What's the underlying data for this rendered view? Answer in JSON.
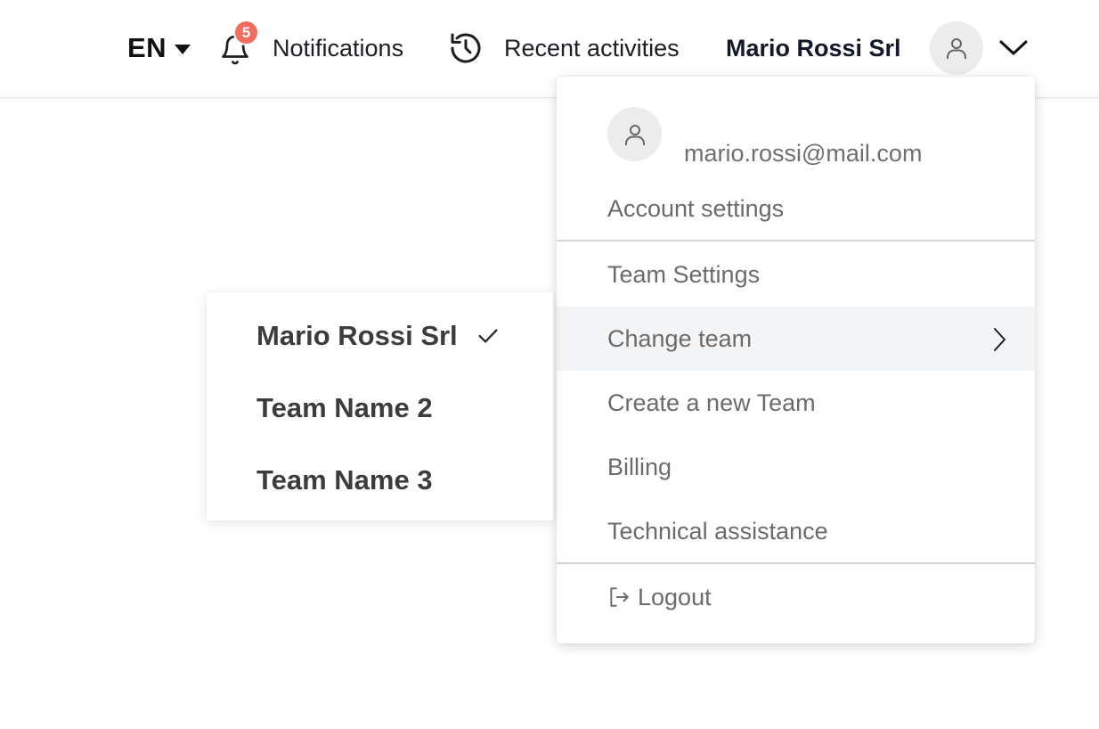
{
  "header": {
    "language": "EN",
    "notifications_label": "Notifications",
    "notifications_count": "5",
    "recent_label": "Recent activities",
    "company_name": "Mario Rossi Srl"
  },
  "menu": {
    "email": "mario.rossi@mail.com",
    "account_settings": "Account settings",
    "team_settings": "Team Settings",
    "change_team": "Change team",
    "create_team": "Create a new Team",
    "billing": "Billing",
    "technical_assistance": "Technical assistance",
    "logout": "Logout"
  },
  "teams": {
    "items": [
      {
        "name": "Mario Rossi Srl",
        "selected": true
      },
      {
        "name": "Team Name 2",
        "selected": false
      },
      {
        "name": "Team Name 3",
        "selected": false
      }
    ]
  },
  "colors": {
    "badge": "#f26d5b",
    "active_row": "#f3f4f5",
    "avatar_bg": "#ececec"
  },
  "icons": [
    "chevron-down-icon",
    "bell-icon",
    "history-icon",
    "user-icon",
    "chevron-right-icon",
    "logout-icon",
    "check-icon"
  ]
}
